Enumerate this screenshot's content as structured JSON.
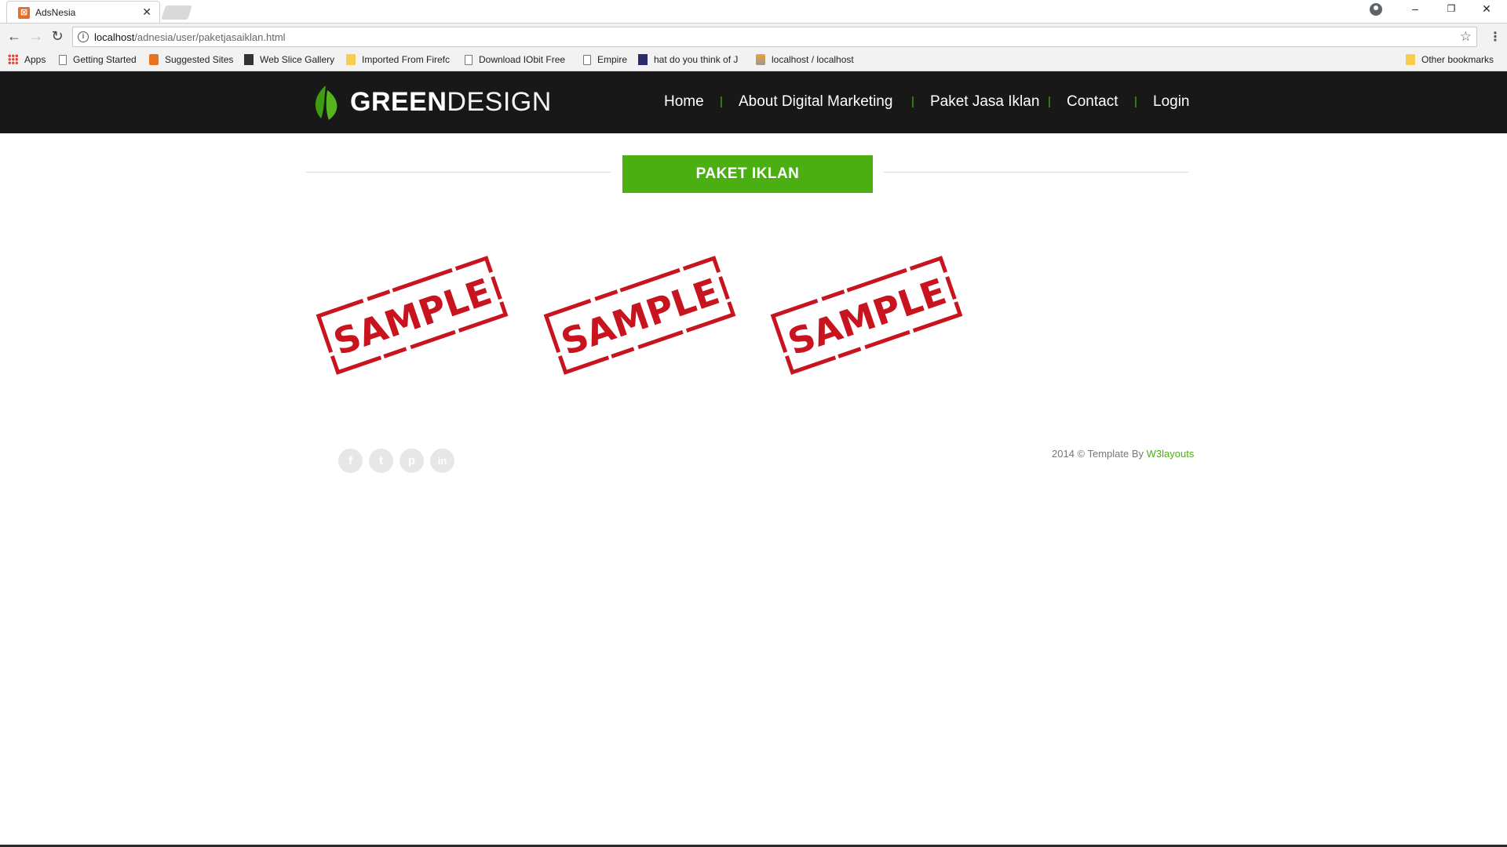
{
  "browser": {
    "tab_title": "AdsNesia",
    "tab_close": "✕",
    "url_host": "localhost",
    "url_path": "/adnesia/user/paketjasaiklan.html",
    "bookmarks": [
      {
        "label": "Apps",
        "icon": "apps-icon"
      },
      {
        "label": "Getting Started",
        "icon": "page-icon"
      },
      {
        "label": "Suggested Sites",
        "icon": "suggested-sites-icon"
      },
      {
        "label": "Web Slice Gallery",
        "icon": "web-slice-icon"
      },
      {
        "label": "Imported From Firefc",
        "icon": "folder-icon"
      },
      {
        "label": "Download IObit Free",
        "icon": "page-icon"
      },
      {
        "label": "Empire",
        "icon": "page-icon"
      },
      {
        "label": "hat do you think of J",
        "icon": "site-icon"
      },
      {
        "label": "localhost / localhost",
        "icon": "phpmyadmin-icon"
      }
    ],
    "other_bookmarks": "Other bookmarks"
  },
  "header": {
    "logo_bold": "GREEN",
    "logo_light": "DESIGN",
    "nav": [
      "Home",
      "About Digital Marketing",
      "Paket Jasa Iklan",
      "Contact",
      "Login"
    ],
    "separator": "|"
  },
  "main": {
    "section_title": "PAKET IKLAN",
    "stamps": [
      "SAMPLE",
      "SAMPLE",
      "SAMPLE"
    ]
  },
  "footer": {
    "social": [
      {
        "glyph": "f",
        "icon": "facebook-icon"
      },
      {
        "glyph": "t",
        "icon": "twitter-icon"
      },
      {
        "glyph": "p",
        "icon": "pinterest-icon"
      },
      {
        "glyph": "in",
        "icon": "linkedin-icon"
      }
    ],
    "copyright_prefix": "2014 © Template By ",
    "copyright_link": "W3layouts"
  },
  "colors": {
    "brand_green": "#4caf11",
    "header_bg": "#181818",
    "stamp_red": "#c8141e"
  }
}
